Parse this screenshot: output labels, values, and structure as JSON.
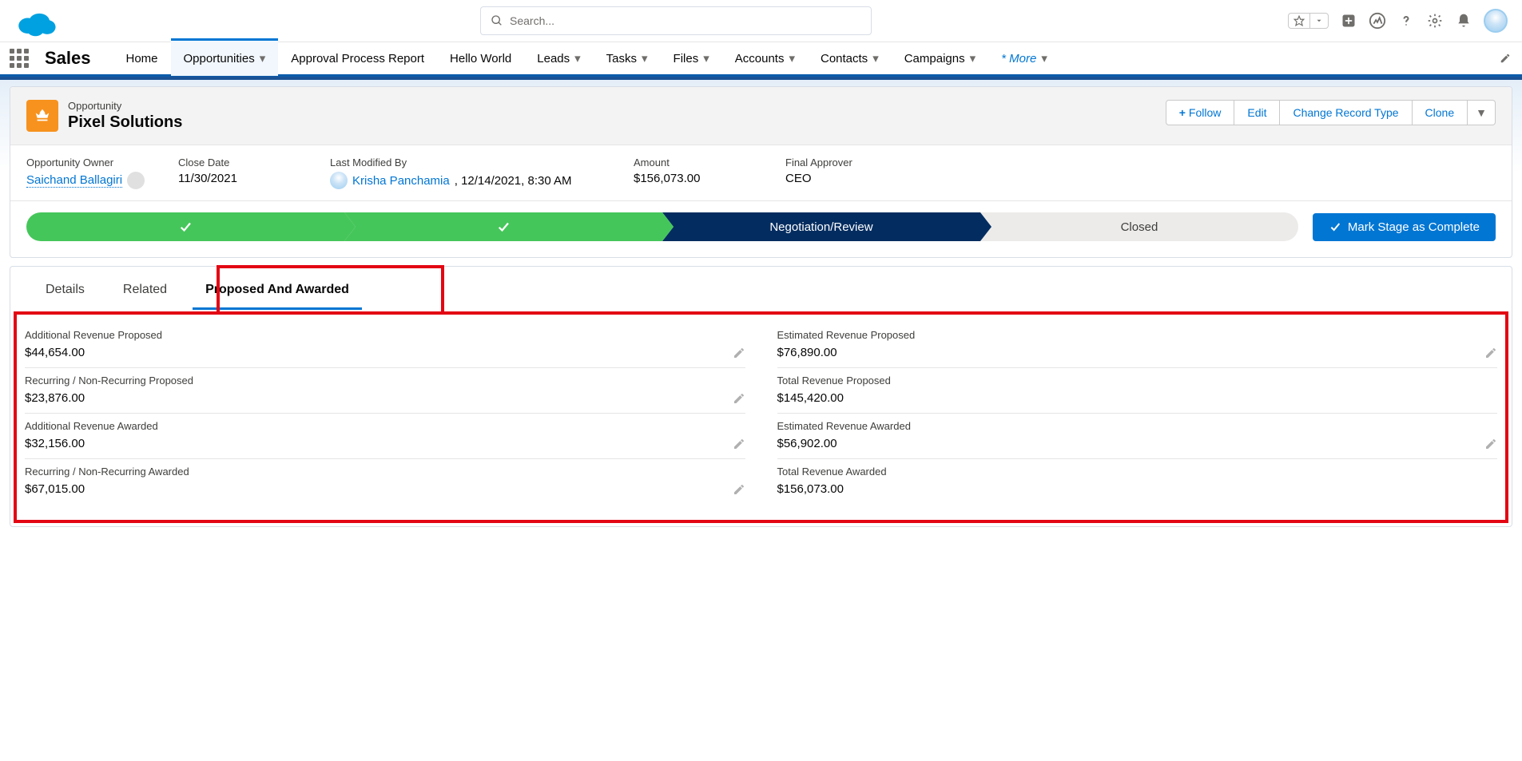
{
  "header": {
    "search_placeholder": "Search..."
  },
  "nav": {
    "app_name": "Sales",
    "items": [
      "Home",
      "Opportunities",
      "Approval Process Report",
      "Hello World",
      "Leads",
      "Tasks",
      "Files",
      "Accounts",
      "Contacts",
      "Campaigns"
    ],
    "more_label": "* More"
  },
  "record": {
    "object_type": "Opportunity",
    "name": "Pixel Solutions",
    "actions": {
      "follow": "Follow",
      "edit": "Edit",
      "change_record_type": "Change Record Type",
      "clone": "Clone"
    }
  },
  "compact_fields": {
    "owner_label": "Opportunity Owner",
    "owner_value": "Saichand Ballagiri",
    "close_date_label": "Close Date",
    "close_date_value": "11/30/2021",
    "last_mod_label": "Last Modified By",
    "last_mod_user": "Krisha Panchamia",
    "last_mod_time": ", 12/14/2021, 8:30 AM",
    "amount_label": "Amount",
    "amount_value": "$156,073.00",
    "final_approver_label": "Final Approver",
    "final_approver_value": "CEO"
  },
  "path": {
    "stage_current": "Negotiation/Review",
    "stage_closed": "Closed",
    "mark_complete": "Mark Stage as Complete"
  },
  "tabs": {
    "details": "Details",
    "related": "Related",
    "proposed_awarded": "Proposed And Awarded"
  },
  "fields_left": [
    {
      "label": "Additional Revenue Proposed",
      "value": "$44,654.00",
      "editable": true
    },
    {
      "label": "Recurring / Non-Recurring Proposed",
      "value": "$23,876.00",
      "editable": true
    },
    {
      "label": "Additional Revenue Awarded",
      "value": "$32,156.00",
      "editable": true
    },
    {
      "label": "Recurring / Non-Recurring Awarded",
      "value": "$67,015.00",
      "editable": true
    }
  ],
  "fields_right": [
    {
      "label": "Estimated Revenue Proposed",
      "value": "$76,890.00",
      "editable": true
    },
    {
      "label": "Total Revenue Proposed",
      "value": "$145,420.00",
      "editable": false
    },
    {
      "label": "Estimated Revenue Awarded",
      "value": "$56,902.00",
      "editable": true
    },
    {
      "label": "Total Revenue Awarded",
      "value": "$156,073.00",
      "editable": false
    }
  ]
}
